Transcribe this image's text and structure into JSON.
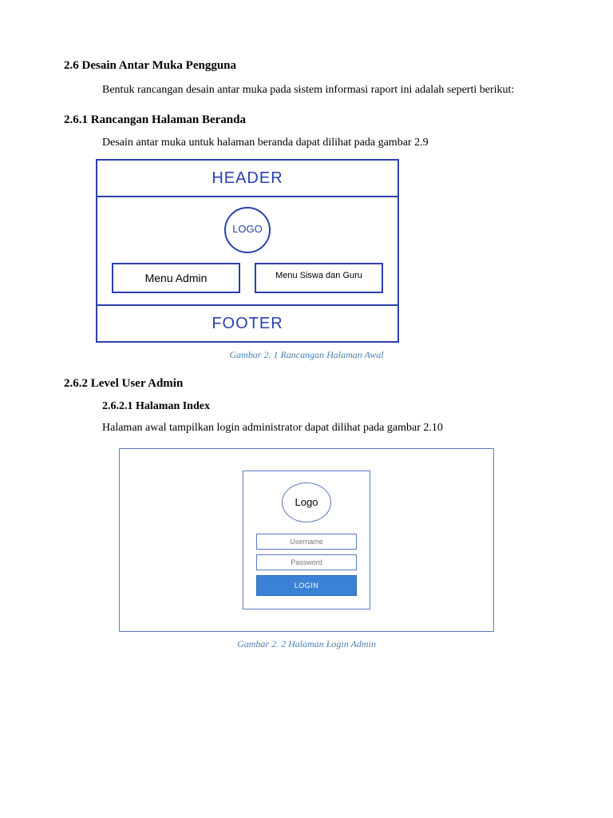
{
  "section26": {
    "title": "2.6 Desain Antar Muka Pengguna",
    "intro": "Bentuk rancangan desain antar muka pada sistem informasi raport ini adalah seperti berikut:"
  },
  "section261": {
    "title": "2.6.1 Rancangan Halaman Beranda",
    "text": "Desain antar muka untuk halaman beranda dapat dilihat pada gambar 2.9"
  },
  "wireframe1": {
    "header": "HEADER",
    "logo": "LOGO",
    "menu_admin": "Menu Admin",
    "menu_siswa": "Menu Siswa dan Guru",
    "footer": "FOOTER",
    "caption": "Gambar 2. 1 Rancangan Halaman Awal"
  },
  "section262": {
    "title": "2.6.2 Level User Admin"
  },
  "section2621": {
    "title": "2.6.2.1 Halaman Index",
    "text": "Halaman awal tampilkan login administrator dapat dilihat pada gambar 2.10"
  },
  "wireframe2": {
    "logo": "Logo",
    "username_placeholder": "Username",
    "password_placeholder": "Password",
    "login_label": "LOGIN",
    "caption": "Gambar 2. 2 Halaman Login Admin"
  }
}
